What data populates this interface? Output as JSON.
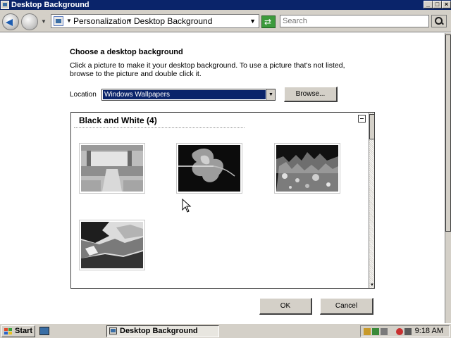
{
  "window": {
    "title": "Desktop Background"
  },
  "nav": {
    "breadcrumb": [
      "Personalization",
      "Desktop Background"
    ],
    "search_placeholder": "Search"
  },
  "content": {
    "heading": "Choose a desktop background",
    "instructions": "Click a picture to make it your desktop background. To use a picture that's not listed, browse to the picture and double click it.",
    "location_label": "Location",
    "location_value": "Windows Wallpapers",
    "browse_label": "Browse...",
    "group_title": "Black and White (4)",
    "thumbnails": [
      {
        "icon": "wallpaper-thumbnail-1"
      },
      {
        "icon": "wallpaper-thumbnail-2"
      },
      {
        "icon": "wallpaper-thumbnail-3"
      },
      {
        "icon": "wallpaper-thumbnail-4"
      }
    ]
  },
  "buttons": {
    "ok": "OK",
    "cancel": "Cancel"
  },
  "taskbar": {
    "start_label": "Start",
    "task_label": "Desktop Background",
    "clock": "9:18 AM"
  },
  "colors": {
    "titlebar": "#0a246a",
    "chrome": "#d4d0c8",
    "selection": "#0a246a"
  }
}
